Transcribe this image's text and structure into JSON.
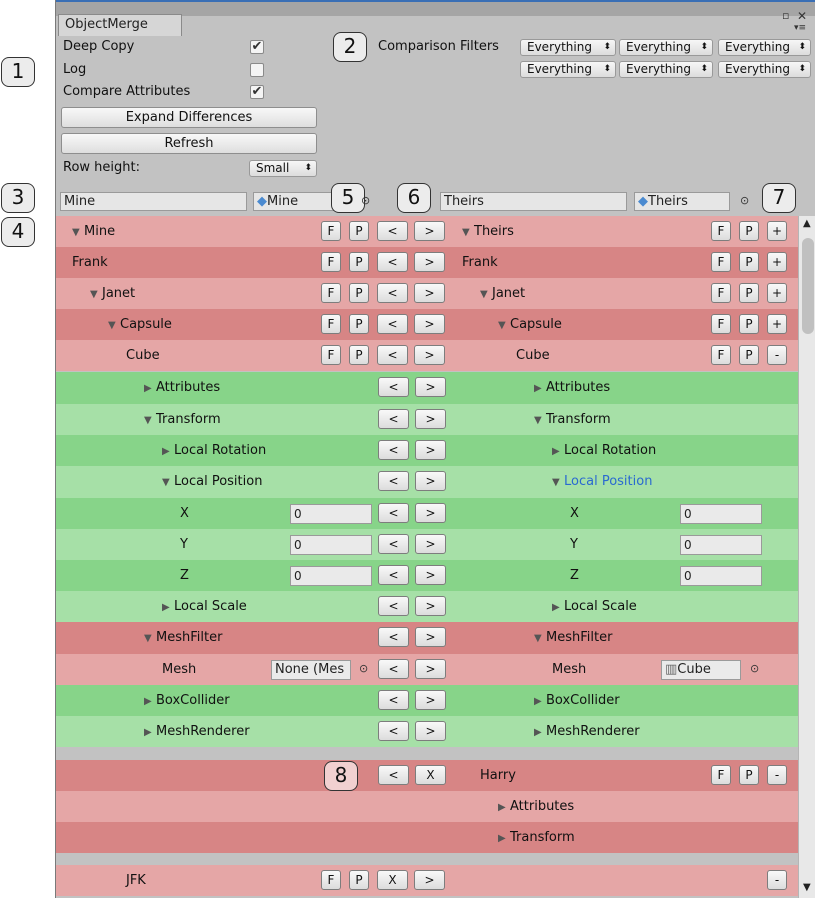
{
  "window": {
    "tab": "ObjectMerge",
    "ctl_max": "▫",
    "ctl_close": "✕",
    "ctl_menu": "▾≡"
  },
  "callouts": [
    "1",
    "2",
    "3",
    "4",
    "5",
    "6",
    "7",
    "8"
  ],
  "options": {
    "deep_copy": {
      "label": "Deep Copy",
      "checked": true
    },
    "log": {
      "label": "Log",
      "checked": false
    },
    "compare_attributes": {
      "label": "Compare Attributes",
      "checked": true
    }
  },
  "buttons": {
    "expand": "Expand Differences",
    "refresh": "Refresh"
  },
  "row_height": {
    "label": "Row height:",
    "value": "Small"
  },
  "filters": {
    "label": "Comparison Filters",
    "values": [
      "Everything",
      "Everything",
      "Everything",
      "Everything",
      "Everything",
      "Everything"
    ]
  },
  "mine": {
    "name": "Mine",
    "object": "Mine"
  },
  "theirs": {
    "name": "Theirs",
    "object": "Theirs"
  },
  "check_mark": "✔",
  "rows": [
    {
      "c": "r2",
      "left": "Mine",
      "ltri": "▼",
      "lind": 0,
      "lbtns": [
        "F",
        "P",
        "<",
        ">"
      ],
      "right": "Theirs",
      "rtri": "▼",
      "rind": 0,
      "rbtns": [
        "F",
        "P",
        "+"
      ]
    },
    {
      "c": "r1",
      "left": "Frank",
      "ltri": "",
      "lind": 0,
      "lbtns": [
        "F",
        "P",
        "<",
        ">"
      ],
      "right": "Frank",
      "rtri": "",
      "rind": 0,
      "rbtns": [
        "F",
        "P",
        "+"
      ]
    },
    {
      "c": "r2",
      "left": "Janet",
      "ltri": "▼",
      "lind": 1,
      "lbtns": [
        "F",
        "P",
        "<",
        ">"
      ],
      "right": "Janet",
      "rtri": "▼",
      "rind": 1,
      "rbtns": [
        "F",
        "P",
        "+"
      ]
    },
    {
      "c": "r1",
      "left": "Capsule",
      "ltri": "▼",
      "lind": 2,
      "lbtns": [
        "F",
        "P",
        "<",
        ">"
      ],
      "right": "Capsule",
      "rtri": "▼",
      "rind": 2,
      "rbtns": [
        "F",
        "P",
        "+"
      ]
    },
    {
      "c": "r2",
      "left": "Cube",
      "ltri": "",
      "lind": 3,
      "lbtns": [
        "F",
        "P",
        "<",
        ">"
      ],
      "right": "Cube",
      "rtri": "",
      "rind": 3,
      "rbtns": [
        "F",
        "P",
        "-"
      ]
    },
    {
      "c": "g1",
      "left": "Attributes",
      "ltri": "▶",
      "lind": 4,
      "lbtns": [
        "<",
        ">"
      ],
      "right": "Attributes",
      "rtri": "▶",
      "rind": 4,
      "rbtns": []
    },
    {
      "c": "g2",
      "left": "Transform",
      "ltri": "▼",
      "lind": 4,
      "lbtns": [
        "<",
        ">"
      ],
      "right": "Transform",
      "rtri": "▼",
      "rind": 4,
      "rbtns": []
    },
    {
      "c": "g1",
      "left": "Local Rotation",
      "ltri": "▶",
      "lind": 5,
      "lbtns": [
        "<",
        ">"
      ],
      "right": "Local Rotation",
      "rtri": "▶",
      "rind": 5,
      "rbtns": []
    },
    {
      "c": "g2",
      "left": "Local Position",
      "ltri": "▼",
      "lind": 5,
      "lbtns": [
        "<",
        ">"
      ],
      "right": "Local Position",
      "rtri": "▼",
      "rind": 5,
      "rbtns": [],
      "rsel": true
    },
    {
      "c": "g1",
      "left": "X",
      "ltri": "",
      "lind": 6,
      "lval": "0",
      "lbtns": [
        "<",
        ">"
      ],
      "right": "X",
      "rtri": "",
      "rind": 6,
      "rval": "0",
      "rbtns": []
    },
    {
      "c": "g2",
      "left": "Y",
      "ltri": "",
      "lind": 6,
      "lval": "0",
      "lbtns": [
        "<",
        ">"
      ],
      "right": "Y",
      "rtri": "",
      "rind": 6,
      "rval": "0",
      "rbtns": []
    },
    {
      "c": "g1",
      "left": "Z",
      "ltri": "",
      "lind": 6,
      "lval": "0",
      "lbtns": [
        "<",
        ">"
      ],
      "right": "Z",
      "rtri": "",
      "rind": 6,
      "rval": "0",
      "rbtns": []
    },
    {
      "c": "g2",
      "left": "Local Scale",
      "ltri": "▶",
      "lind": 5,
      "lbtns": [
        "<",
        ">"
      ],
      "right": "Local Scale",
      "rtri": "▶",
      "rind": 5,
      "rbtns": []
    },
    {
      "c": "r1",
      "left": "MeshFilter",
      "ltri": "▼",
      "lind": 4,
      "lbtns": [
        "<",
        ">"
      ],
      "right": "MeshFilter",
      "rtri": "▼",
      "rind": 4,
      "rbtns": []
    },
    {
      "c": "r2",
      "left": "Mesh",
      "ltri": "",
      "lind": 5,
      "lobj": "None (Mes",
      "lbtns": [
        "<",
        ">"
      ],
      "right": "Mesh",
      "rtri": "",
      "rind": 5,
      "robj": "Cube",
      "rbtns": []
    },
    {
      "c": "g1",
      "left": "BoxCollider",
      "ltri": "▶",
      "lind": 4,
      "lbtns": [
        "<",
        ">"
      ],
      "right": "BoxCollider",
      "rtri": "▶",
      "rind": 4,
      "rbtns": []
    },
    {
      "c": "g2",
      "left": "MeshRenderer",
      "ltri": "▶",
      "lind": 4,
      "lbtns": [
        "<",
        ">"
      ],
      "right": "MeshRenderer",
      "rtri": "▶",
      "rind": 4,
      "rbtns": []
    },
    {
      "c": "gap"
    },
    {
      "c": "r1",
      "left": "",
      "ltri": "",
      "lind": 0,
      "lbtns": [
        "<",
        "X"
      ],
      "right": "Harry",
      "rtri": "",
      "rind": 1,
      "rbtns": [
        "F",
        "P",
        "-"
      ]
    },
    {
      "c": "r2",
      "left": "",
      "ltri": "",
      "lind": 0,
      "lbtns": [],
      "right": "Attributes",
      "rtri": "▶",
      "rind": 2,
      "rbtns": []
    },
    {
      "c": "r1",
      "left": "",
      "ltri": "",
      "lind": 0,
      "lbtns": [],
      "right": "Transform",
      "rtri": "▶",
      "rind": 2,
      "rbtns": []
    },
    {
      "c": "gap"
    },
    {
      "c": "r2",
      "left": "JFK",
      "ltri": "",
      "lind": 3,
      "lbtns": [
        "F",
        "P",
        "X",
        ">"
      ],
      "right": "",
      "rtri": "",
      "rind": 0,
      "rbtns": [
        "-"
      ]
    }
  ],
  "scroll": {
    "up": "▲",
    "down": "▼"
  }
}
